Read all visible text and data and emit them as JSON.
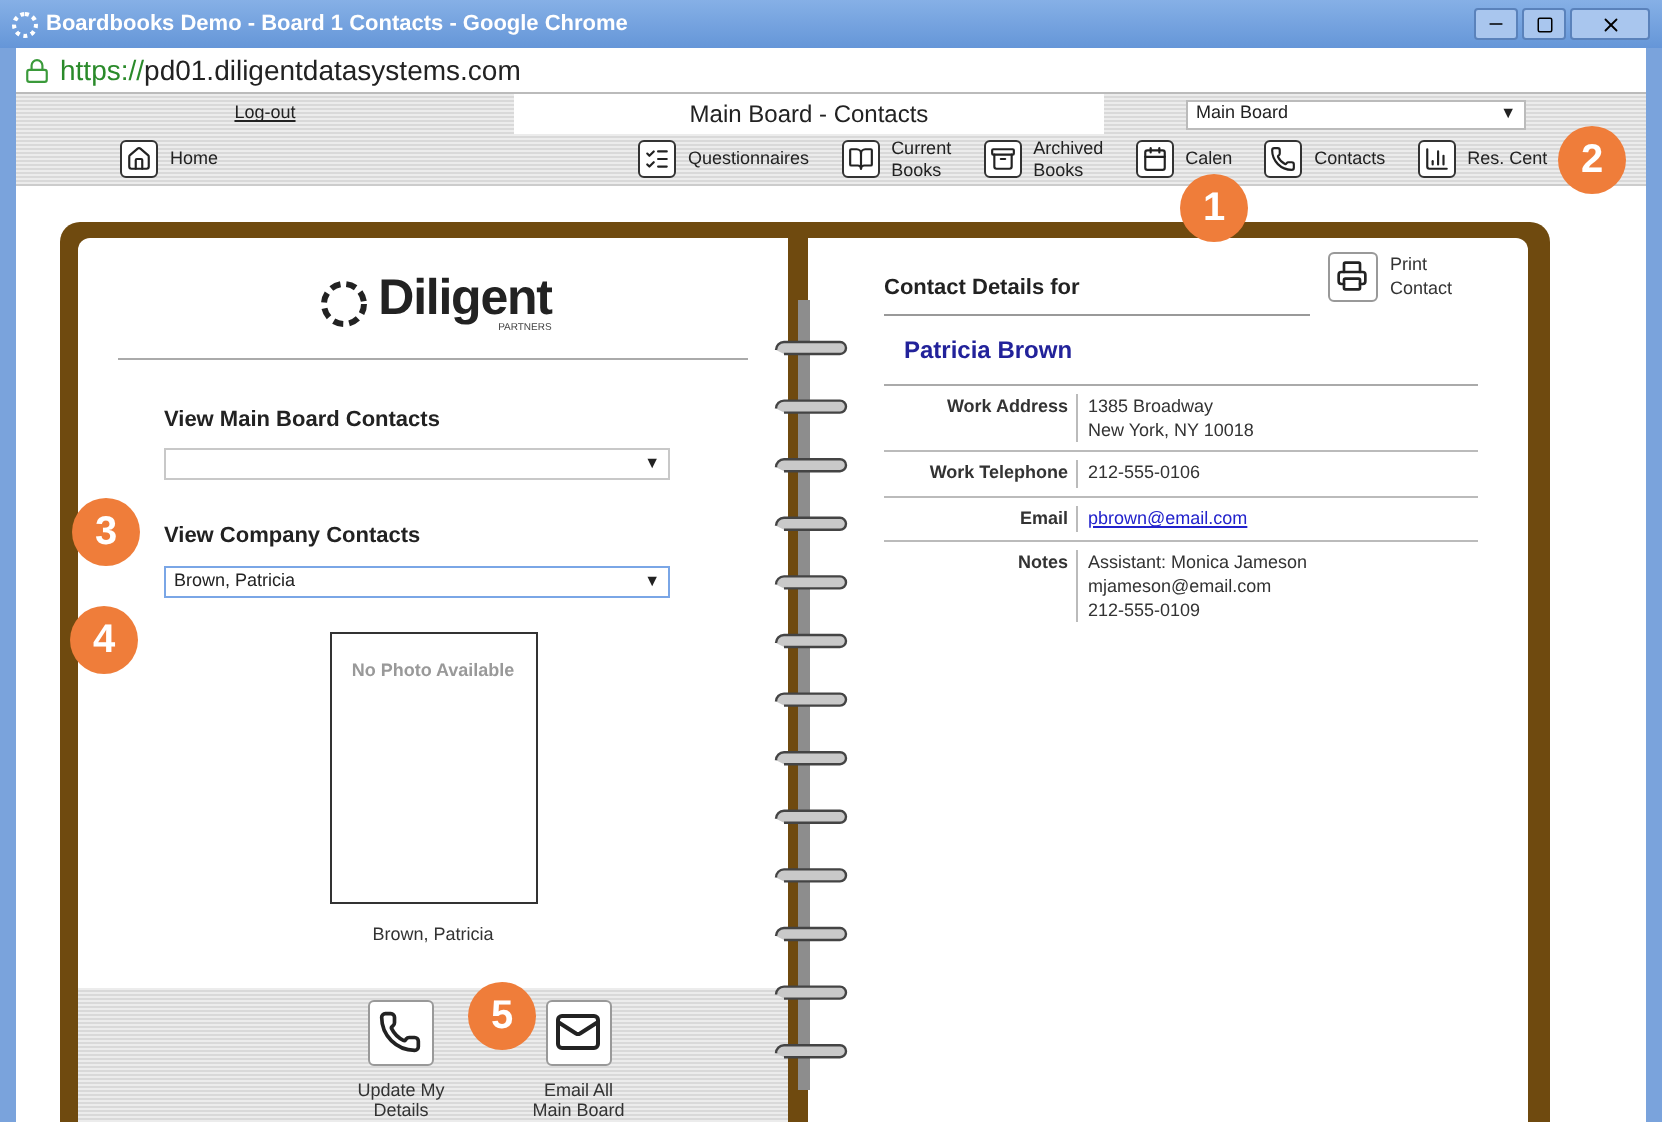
{
  "window": {
    "title": "Boardbooks Demo - Board 1 Contacts - Google Chrome"
  },
  "address_bar": {
    "scheme": "https://",
    "host": "pd01.diligentdatasystems.com"
  },
  "header": {
    "logout": "Log-out",
    "page_title": "Main Board - Contacts",
    "board_select": {
      "value": "Main Board",
      "arrow": "▼"
    }
  },
  "nav": [
    {
      "kind": "home",
      "lines": [
        "Home"
      ]
    },
    {
      "kind": "questionnaire",
      "lines": [
        "Questionnaires"
      ]
    },
    {
      "kind": "book",
      "lines": [
        "Current",
        "Books"
      ]
    },
    {
      "kind": "archive",
      "lines": [
        "Archived",
        "Books"
      ]
    },
    {
      "kind": "calendar",
      "lines": [
        "Calen"
      ]
    },
    {
      "kind": "phone",
      "lines": [
        "Contacts"
      ]
    },
    {
      "kind": "chart",
      "lines": [
        "Res. Cent"
      ]
    }
  ],
  "left_page": {
    "logo": {
      "name": "Diligent",
      "tagline": "PARTNERS"
    },
    "main_board_contacts": {
      "label": "View Main Board Contacts",
      "arrow": "▼",
      "focused": false
    },
    "company_contacts": {
      "label": "View Company Contacts",
      "value": "Brown, Patricia",
      "arrow": "▼",
      "focused": true
    },
    "photo": {
      "placeholder": "No Photo Available",
      "caption": "Brown, Patricia"
    },
    "actions": [
      {
        "kind": "phone",
        "lines": [
          "Update My",
          "Details"
        ]
      },
      {
        "kind": "mail",
        "lines": [
          "Email All",
          "Main Board"
        ]
      }
    ]
  },
  "right_page": {
    "heading": "Contact Details for",
    "print": {
      "lines": [
        "Print",
        "Contact"
      ]
    },
    "name": "Patricia Brown",
    "fields": [
      {
        "kind": "text",
        "label": "Work Address",
        "lines": [
          "1385 Broadway",
          "New York, NY 10018"
        ]
      },
      {
        "kind": "text",
        "label": "Work Telephone",
        "lines": [
          "212-555-0106"
        ]
      },
      {
        "kind": "link",
        "label": "Email",
        "lines": [
          "pbrown@email.com"
        ]
      },
      {
        "kind": "text",
        "label": "Notes",
        "lines": [
          "Assistant: Monica Jameson",
          "mjameson@email.com",
          "212-555-0109"
        ]
      }
    ]
  },
  "callouts": [
    "1",
    "2",
    "3",
    "4",
    "5"
  ]
}
